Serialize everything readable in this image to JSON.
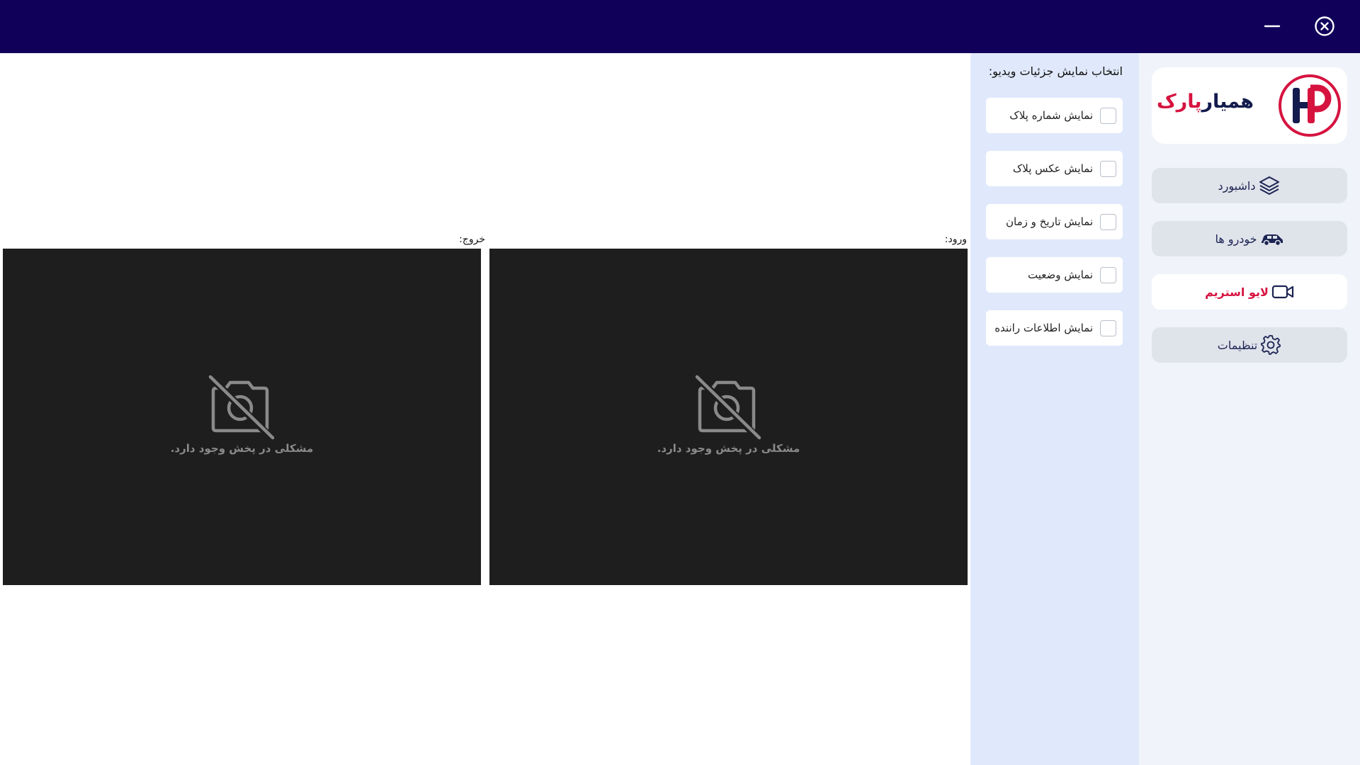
{
  "window": {
    "controls": [
      "close-icon",
      "minimize-icon"
    ]
  },
  "sidebar": {
    "logo": {
      "text_part1": "همیار",
      "text_part2": "پارک",
      "mark": "hp-logo-icon"
    },
    "items": [
      {
        "label": "داشبورد",
        "icon": "layers-icon",
        "active": false
      },
      {
        "label": "خودرو ها",
        "icon": "car-icon",
        "active": false
      },
      {
        "label": "لایو استریم",
        "icon": "video-camera-icon",
        "active": true
      },
      {
        "label": "تنظیمات",
        "icon": "gear-icon",
        "active": false
      }
    ]
  },
  "options": {
    "title": "انتخاب نمایش جزئیات ویدیو:",
    "items": [
      {
        "label": "نمایش شماره پلاک",
        "checked": false
      },
      {
        "label": "نمایش عکس پلاک",
        "checked": false
      },
      {
        "label": "نمایش تاریخ و زمان",
        "checked": false
      },
      {
        "label": "نمایش وضعیت",
        "checked": false
      },
      {
        "label": "نمایش اطلاعات راننده",
        "checked": false
      }
    ]
  },
  "cameras": {
    "entry": {
      "label": "ورود:",
      "message": "مشکلی در پخش وجود دارد.",
      "icon": "camera-off-icon"
    },
    "exit": {
      "label": "خروج:",
      "message": "مشکلی در پخش وجود دارد.",
      "icon": "camera-off-icon"
    }
  },
  "colors": {
    "titlebar": "#10005a",
    "brand_navy": "#141b4d",
    "brand_red": "#d6133f",
    "sidebar_bg": "#f0f3fa",
    "options_bg": "#e0e9fb",
    "video_bg": "#1e1e1e"
  }
}
